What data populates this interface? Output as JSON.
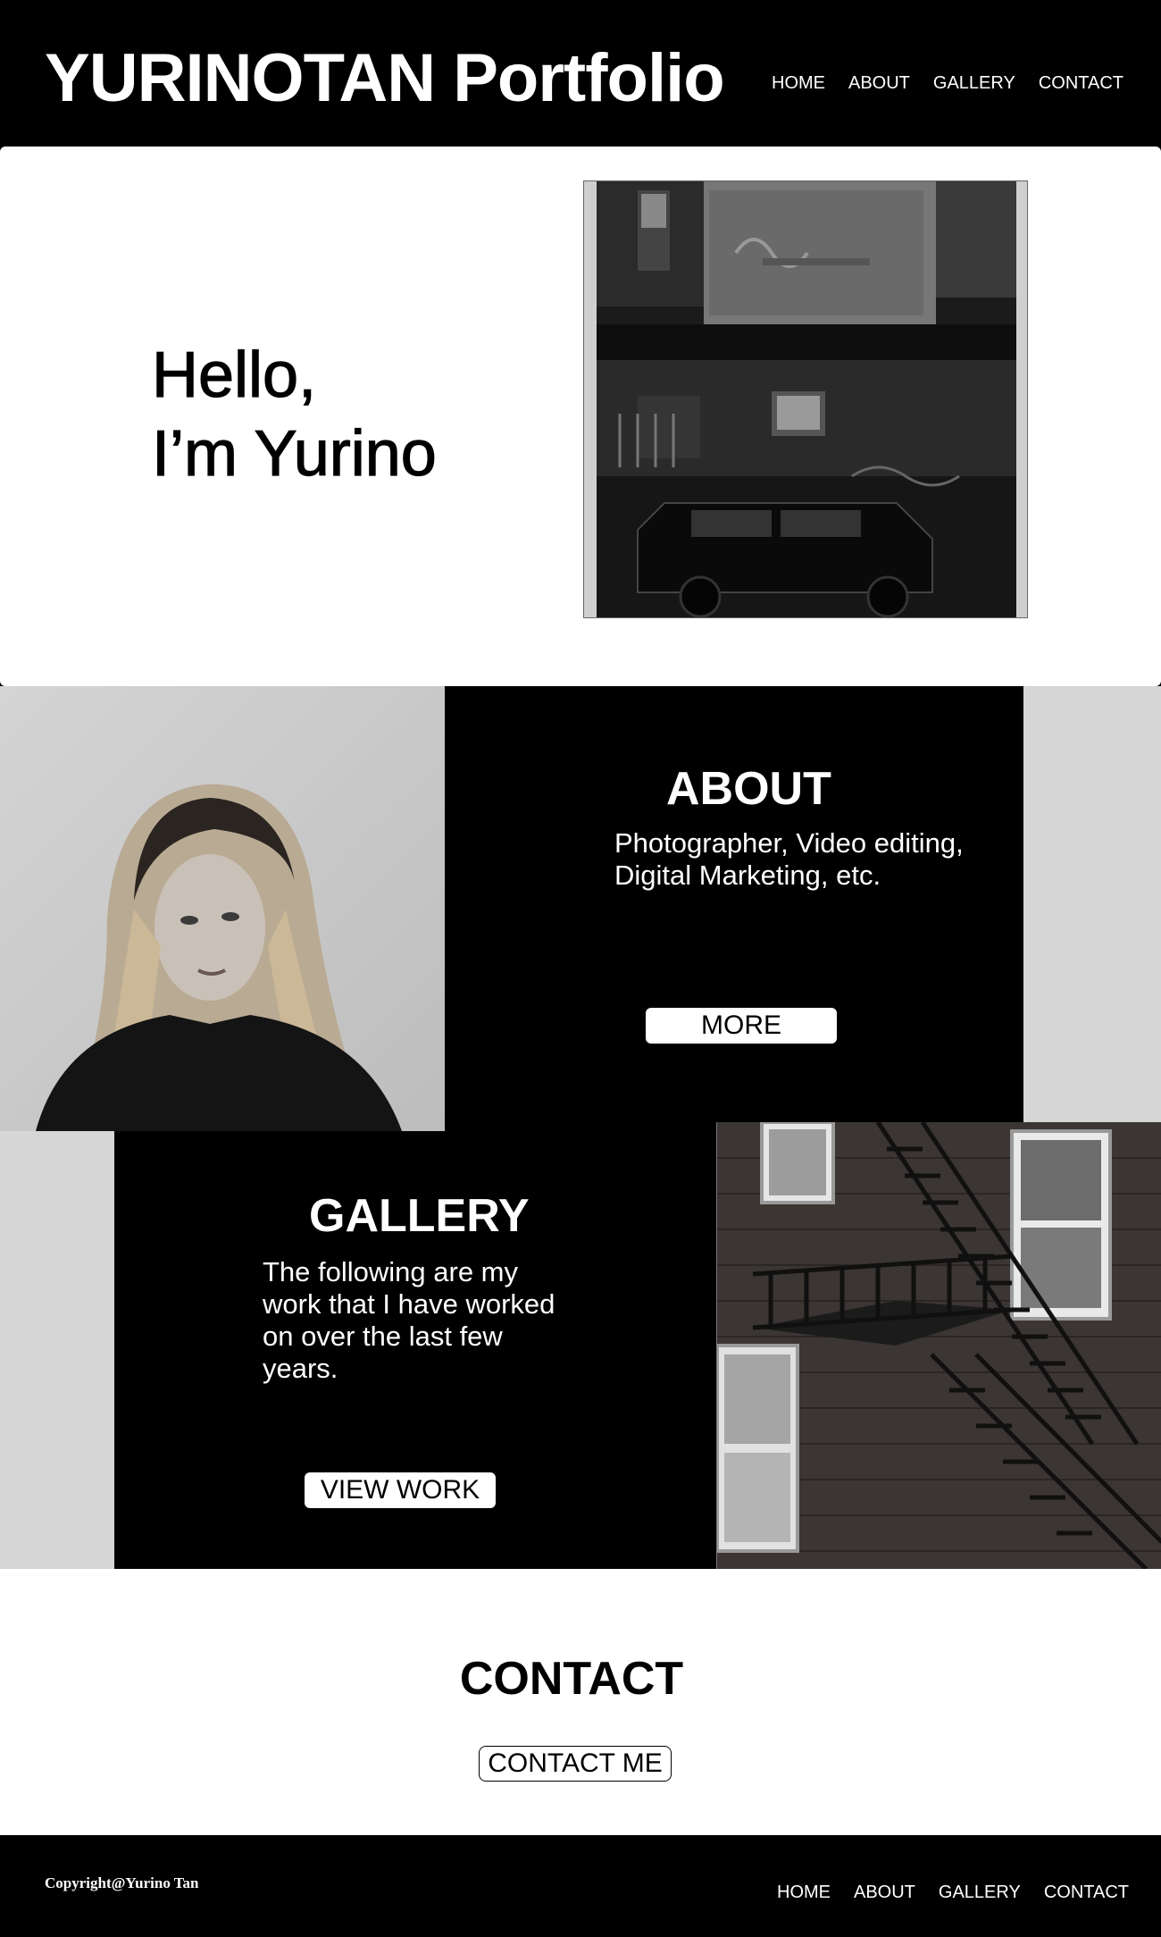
{
  "header": {
    "brand": "YURINOTAN Portfolio",
    "nav": [
      "HOME",
      "ABOUT",
      "GALLERY",
      "CONTACT"
    ]
  },
  "hero": {
    "title": "Hello,\nI’m Yurino"
  },
  "about": {
    "title": "ABOUT",
    "text": "Photographer, Video editing, Digital Marketing, etc.",
    "button": "MORE"
  },
  "gallery": {
    "title": "GALLERY",
    "text": "The following are my work that I have worked on over the last few years.",
    "button": "VIEW WORK"
  },
  "contact": {
    "title": "CONTACT",
    "button": "CONTACT ME"
  },
  "footer": {
    "copyright": "Copyright@Yurino Tan",
    "nav": [
      "HOME",
      "ABOUT",
      "GALLERY",
      "CONTACT"
    ]
  },
  "colors": {
    "background": "#000000",
    "panel_light": "#ffffff",
    "side_gray": "#d6d6d6"
  }
}
